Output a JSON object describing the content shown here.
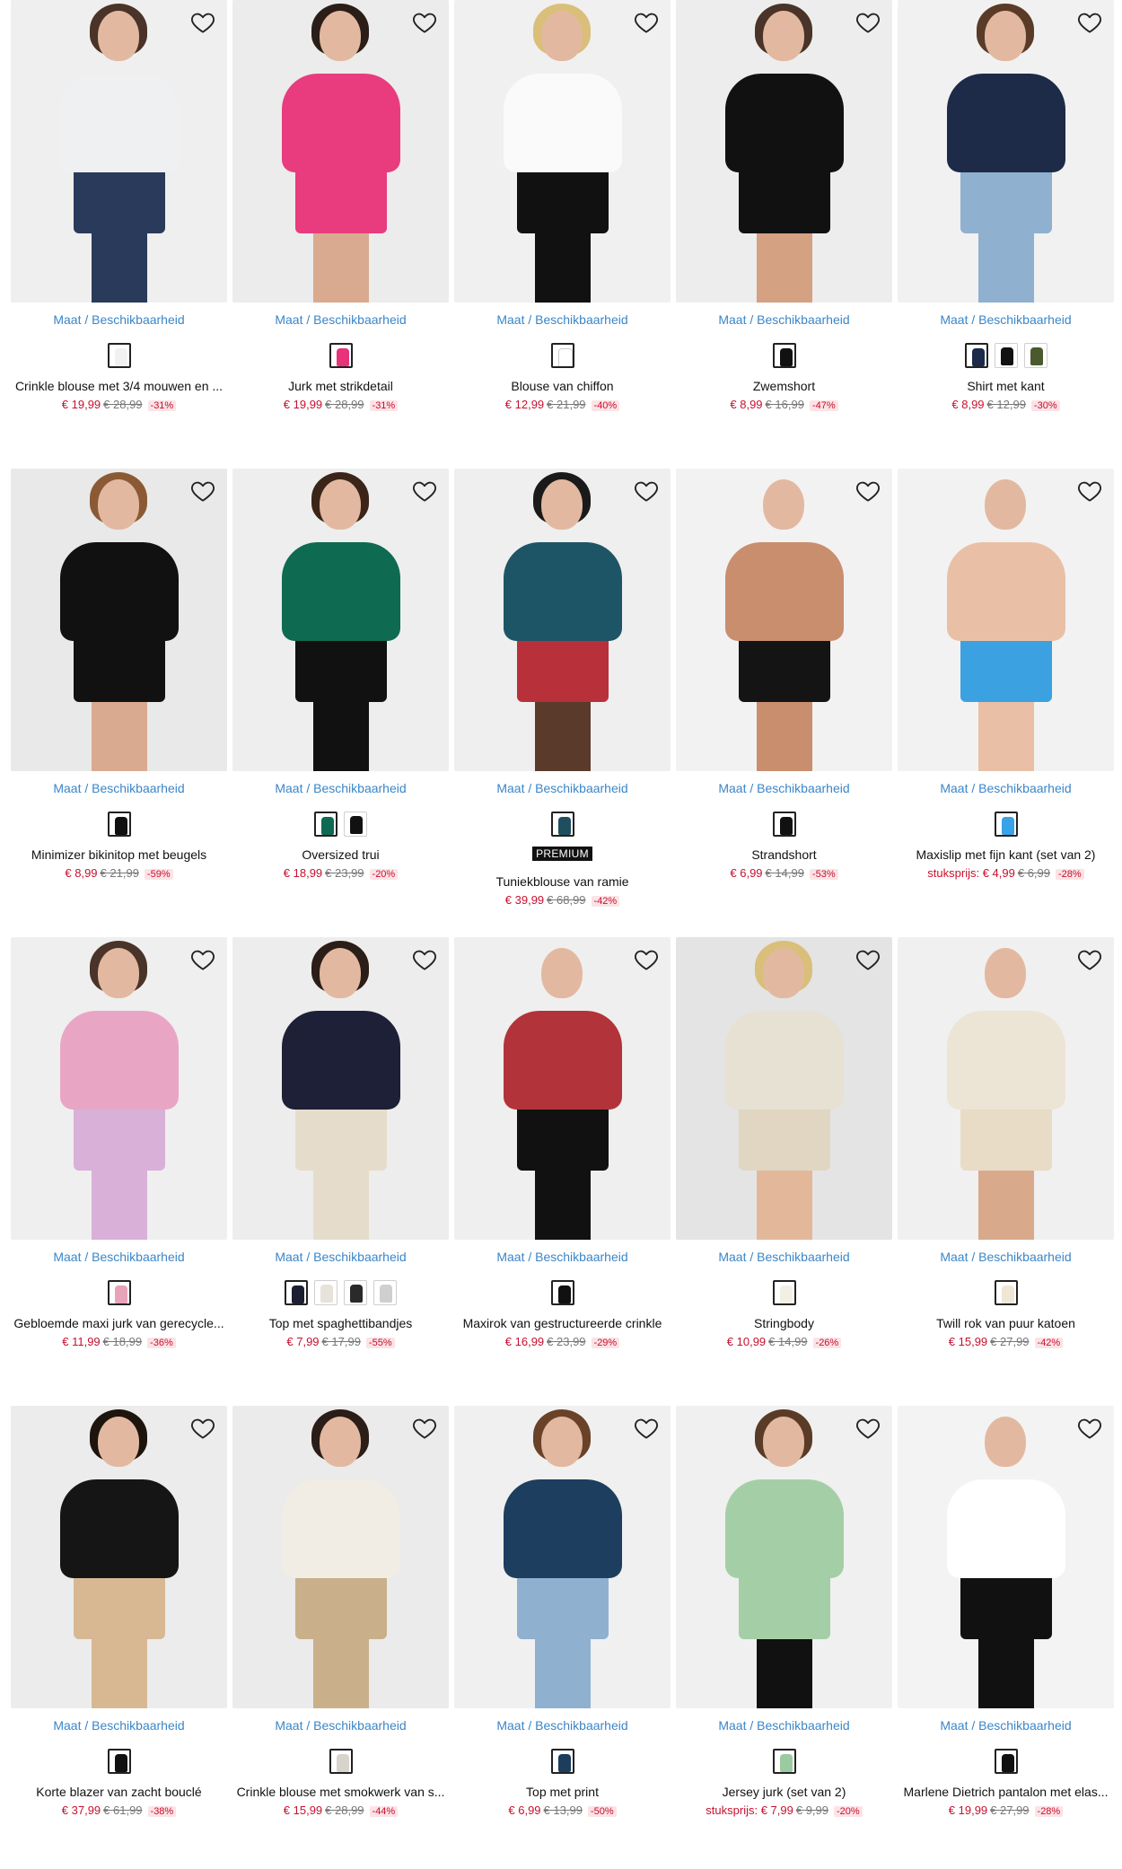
{
  "maat_label": "Maat / Beschikbaarheid",
  "premium_label": "PREMIUM",
  "colors": {
    "link": "#3a86c8",
    "sale": "#c8102e",
    "discount_bg": "#fbe3e6"
  },
  "products": [
    {
      "name": "Crinkle blouse met 3/4 mouwen en ...",
      "price": "€ 19,99",
      "old_price": "€ 28,99",
      "discount": "-31%",
      "label": "",
      "premium": false,
      "swatches": [
        "#f1f1f1"
      ],
      "bg": "#efefef",
      "hair": "#4a3328",
      "top": "#eef0f2",
      "bottom": "#2a3a5a",
      "legs": "#2a3a5a"
    },
    {
      "name": "Jurk met strikdetail",
      "price": "€ 19,99",
      "old_price": "€ 28,99",
      "discount": "-31%",
      "label": "",
      "premium": false,
      "swatches": [
        "#e8327a"
      ],
      "bg": "#ececec",
      "hair": "#2b1d17",
      "top": "#e83c7e",
      "bottom": "#e83c7e",
      "legs": "#d9aa8f"
    },
    {
      "name": "Blouse van chiffon",
      "price": "€ 12,99",
      "old_price": "€ 21,99",
      "discount": "-40%",
      "label": "",
      "premium": false,
      "swatches": [
        "#ffffff"
      ],
      "bg": "#f0f0f0",
      "hair": "#d9bf7a",
      "top": "#fafafa",
      "bottom": "#111111",
      "legs": "#111111"
    },
    {
      "name": "Zwemshort",
      "price": "€ 8,99",
      "old_price": "€ 16,99",
      "discount": "-47%",
      "label": "",
      "premium": false,
      "swatches": [
        "#111111"
      ],
      "bg": "#ededed",
      "hair": "#4a3328",
      "top": "#111111",
      "bottom": "#111111",
      "legs": "#d4a183"
    },
    {
      "name": "Shirt met kant",
      "price": "€ 8,99",
      "old_price": "€ 12,99",
      "discount": "-30%",
      "label": "",
      "premium": false,
      "swatches": [
        "#1c2a4a",
        "#111111",
        "#4a5a2c"
      ],
      "bg": "#f1f1f1",
      "hair": "#5a3b28",
      "top": "#1d2a48",
      "bottom": "#8fb0cf",
      "legs": "#8fb0cf"
    },
    {
      "name": "Minimizer bikinitop met beugels",
      "price": "€ 8,99",
      "old_price": "€ 21,99",
      "discount": "-59%",
      "label": "",
      "premium": false,
      "swatches": [
        "#111111"
      ],
      "bg": "#e9e9e9",
      "hair": "#8b5a34",
      "top": "#111111",
      "bottom": "#111111",
      "legs": "#d9aa8f"
    },
    {
      "name": "Oversized trui",
      "price": "€ 18,99",
      "old_price": "€ 23,99",
      "discount": "-20%",
      "label": "",
      "premium": false,
      "swatches": [
        "#0e6a52",
        "#111111"
      ],
      "bg": "#eeeeee",
      "hair": "#3b2518",
      "top": "#0e6a50",
      "bottom": "#111111",
      "legs": "#111111"
    },
    {
      "name": "Tuniekblouse van ramie",
      "price": "€ 39,99",
      "old_price": "€ 68,99",
      "discount": "-42%",
      "label": "",
      "premium": true,
      "swatches": [
        "#1f4f5f"
      ],
      "bg": "#efefef",
      "hair": "#1a1a1a",
      "top": "#1e5566",
      "bottom": "#b8303a",
      "legs": "#5a3a2a"
    },
    {
      "name": "Strandshort",
      "price": "€ 6,99",
      "old_price": "€ 14,99",
      "discount": "-53%",
      "label": "",
      "premium": false,
      "swatches": [
        "#111111"
      ],
      "bg": "#f2f2f2",
      "hair": "#f2f2f2",
      "top": "#c98e6e",
      "bottom": "#141414",
      "legs": "#c98e6e"
    },
    {
      "name": "Maxislip met fijn kant (set van 2)",
      "price": "€ 4,99",
      "old_price": "€ 6,99",
      "discount": "-28%",
      "label": "stuksprijs:",
      "premium": false,
      "swatches": [
        "#38a3e6"
      ],
      "bg": "#f2f2f2",
      "hair": "#f2f2f2",
      "top": "#e9c0a6",
      "bottom": "#3ba1e0",
      "legs": "#e9c0a6"
    },
    {
      "name": "Gebloemde maxi jurk van gerecycle...",
      "price": "€ 11,99",
      "old_price": "€ 18,99",
      "discount": "-36%",
      "label": "",
      "premium": false,
      "swatches": [
        "#e7a3b8"
      ],
      "bg": "#efefef",
      "hair": "#4a3328",
      "top": "#e9a6c4",
      "bottom": "#d9b0d8",
      "legs": "#d9b0d8"
    },
    {
      "name": "Top met spaghettibandjes",
      "price": "€ 7,99",
      "old_price": "€ 17,99",
      "discount": "-55%",
      "label": "",
      "premium": false,
      "swatches": [
        "#1d1f33",
        "#e7e2da",
        "#2a2a2a",
        "#cfcfcf"
      ],
      "bg": "#ededed",
      "hair": "#2b1d17",
      "top": "#1d2036",
      "bottom": "#e6dccb",
      "legs": "#e6dccb"
    },
    {
      "name": "Maxirok van gestructureerde crinkle",
      "price": "€ 16,99",
      "old_price": "€ 23,99",
      "discount": "-29%",
      "label": "",
      "premium": false,
      "swatches": [
        "#111111"
      ],
      "bg": "#efefef",
      "hair": "#efefef",
      "top": "#b3333a",
      "bottom": "#111111",
      "legs": "#111111"
    },
    {
      "name": "Stringbody",
      "price": "€ 10,99",
      "old_price": "€ 14,99",
      "discount": "-26%",
      "label": "",
      "premium": false,
      "swatches": [
        "#f2efe4"
      ],
      "bg": "#e4e4e4",
      "hair": "#d9bf7a",
      "top": "#e6e1d2",
      "bottom": "#e0d6c2",
      "legs": "#e3b79a"
    },
    {
      "name": "Twill rok van puur katoen",
      "price": "€ 15,99",
      "old_price": "€ 27,99",
      "discount": "-42%",
      "label": "",
      "premium": false,
      "swatches": [
        "#efe6d6"
      ],
      "bg": "#f0f0f0",
      "hair": "#f0f0f0",
      "top": "#ece4d4",
      "bottom": "#e8dcc6",
      "legs": "#d8a98a"
    },
    {
      "name": "Korte blazer van zacht bouclé",
      "price": "€ 37,99",
      "old_price": "€ 61,99",
      "discount": "-38%",
      "label": "",
      "premium": false,
      "swatches": [
        "#111111"
      ],
      "bg": "#ececec",
      "hair": "#1e140e",
      "top": "#151515",
      "bottom": "#d8b892",
      "legs": "#d8b892"
    },
    {
      "name": "Crinkle blouse met smokwerk van s...",
      "price": "€ 15,99",
      "old_price": "€ 28,99",
      "discount": "-44%",
      "label": "",
      "premium": false,
      "swatches": [
        "#d8d4cc"
      ],
      "bg": "#ebebeb",
      "hair": "#2b1d17",
      "top": "#f1ece4",
      "bottom": "#c9b08a",
      "legs": "#c9b08a"
    },
    {
      "name": "Top met print",
      "price": "€ 6,99",
      "old_price": "€ 13,99",
      "discount": "-50%",
      "label": "",
      "premium": false,
      "swatches": [
        "#1c3d5c"
      ],
      "bg": "#f0f0f0",
      "hair": "#6a4228",
      "top": "#1d3e5e",
      "bottom": "#8fb0cf",
      "legs": "#8fb0cf"
    },
    {
      "name": "Jersey jurk (set van 2)",
      "price": "€ 7,99",
      "old_price": "€ 9,99",
      "discount": "-20%",
      "label": "stuksprijs:",
      "premium": false,
      "swatches": [
        "#9ccaa0"
      ],
      "bg": "#f0f0f0",
      "hair": "#5a3b28",
      "top": "#a4cfa6",
      "bottom": "#a4cfa6",
      "legs": "#111111"
    },
    {
      "name": "Marlene Dietrich pantalon met elas...",
      "price": "€ 19,99",
      "old_price": "€ 27,99",
      "discount": "-28%",
      "label": "",
      "premium": false,
      "swatches": [
        "#111111"
      ],
      "bg": "#f3f3f3",
      "hair": "#f3f3f3",
      "top": "#ffffff",
      "bottom": "#111111",
      "legs": "#111111"
    }
  ]
}
